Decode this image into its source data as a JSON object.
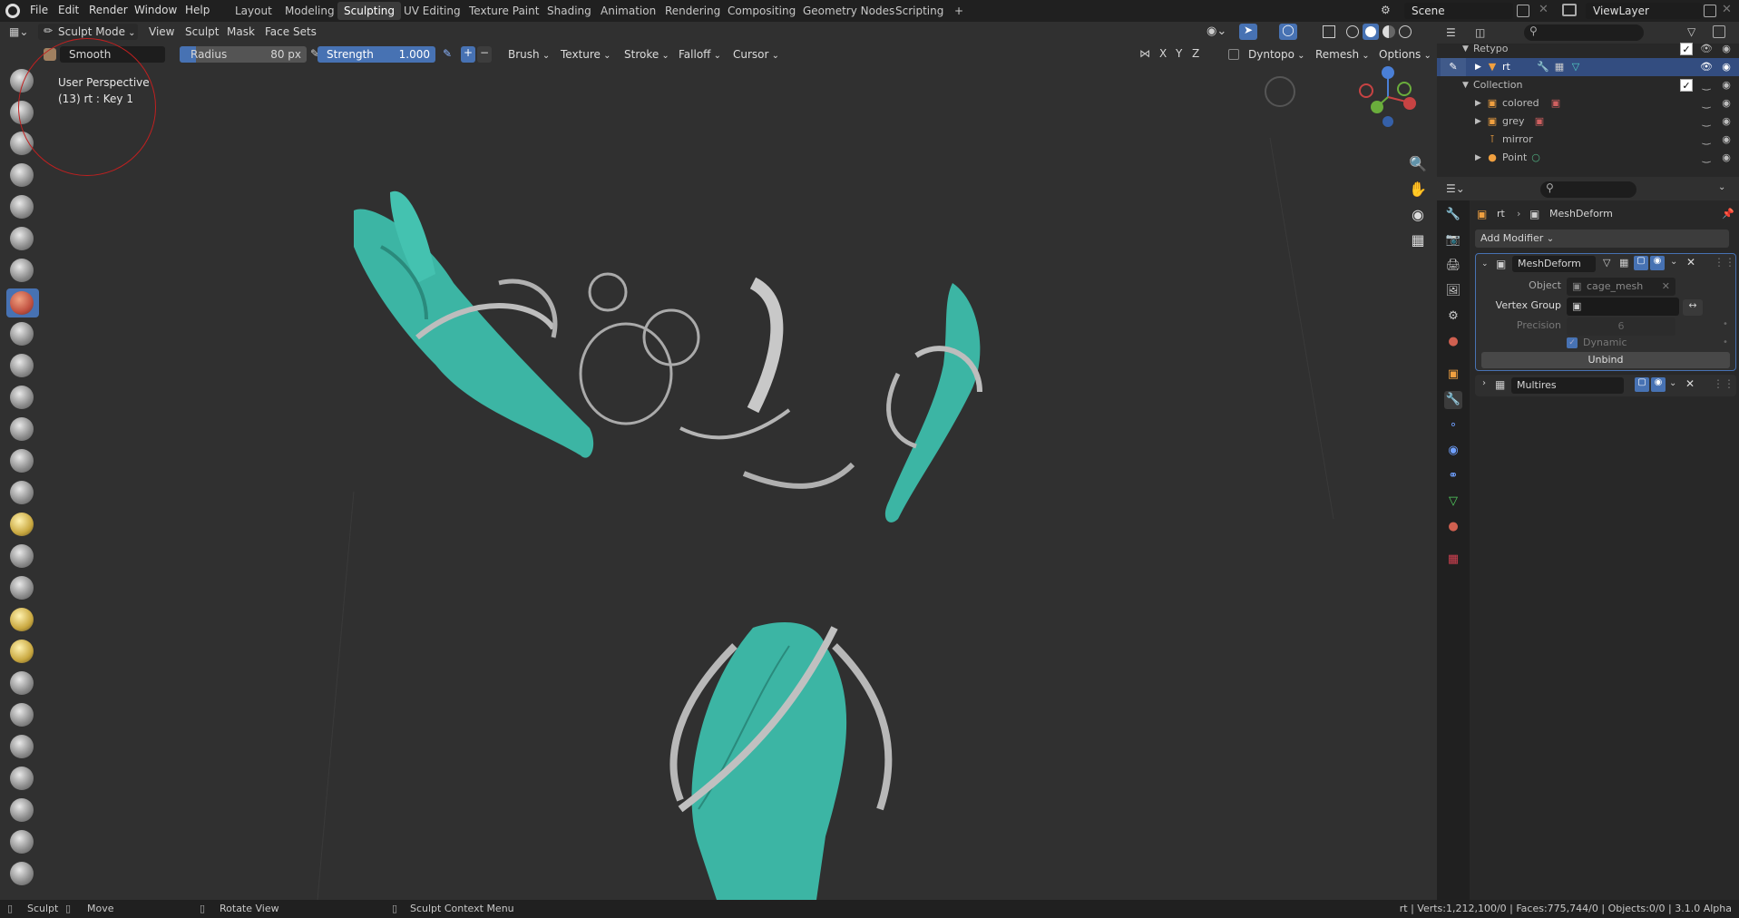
{
  "menubar": {
    "items": [
      "File",
      "Edit",
      "Render",
      "Window",
      "Help"
    ],
    "workspaces": [
      "Layout",
      "Modeling",
      "Sculpting",
      "UV Editing",
      "Texture Paint",
      "Shading",
      "Animation",
      "Rendering",
      "Compositing",
      "Geometry Nodes",
      "Scripting",
      "+"
    ],
    "active_workspace": "Sculpting",
    "scene": "Scene",
    "view_layer": "ViewLayer"
  },
  "header": {
    "mode": "Sculpt Mode",
    "menus": [
      "View",
      "Sculpt",
      "Mask",
      "Face Sets"
    ]
  },
  "tool_settings": {
    "brush_name": "Smooth",
    "radius_label": "Radius",
    "radius_value": "80 px",
    "strength_label": "Strength",
    "strength_value": "1.000",
    "menus": [
      "Brush",
      "Texture",
      "Stroke",
      "Falloff",
      "Cursor"
    ],
    "axes": [
      "X",
      "Y",
      "Z"
    ],
    "dyntopo": "Dyntopo",
    "remesh": "Remesh",
    "options": "Options"
  },
  "viewport": {
    "perspective": "User Perspective",
    "object_info": "(13) rt : Key 1",
    "accent_color": "#3cb5a4"
  },
  "outliner": {
    "rows": [
      {
        "label": "Retypo",
        "depth": 1,
        "selected": false
      },
      {
        "label": "rt",
        "depth": 2,
        "selected": true
      },
      {
        "label": "Collection",
        "depth": 1,
        "selected": false
      },
      {
        "label": "colored",
        "depth": 2,
        "selected": false
      },
      {
        "label": "grey",
        "depth": 2,
        "selected": false
      },
      {
        "label": "mirror",
        "depth": 2,
        "selected": false
      },
      {
        "label": "Point",
        "depth": 2,
        "selected": false
      }
    ]
  },
  "properties": {
    "breadcrumb_object": "rt",
    "breadcrumb_modifier": "MeshDeform",
    "add_modifier": "Add Modifier",
    "meshdeform": {
      "name": "MeshDeform",
      "object_label": "Object",
      "object_value": "cage_mesh",
      "vertex_group_label": "Vertex Group",
      "precision_label": "Precision",
      "precision_value": "6",
      "dynamic_label": "Dynamic",
      "unbind_label": "Unbind"
    },
    "multires": {
      "name": "Multires"
    }
  },
  "statusbar": {
    "left": [
      "Sculpt",
      "Move",
      "Rotate View",
      "Sculpt Context Menu"
    ],
    "right": "rt | Verts:1,212,100/0 | Faces:775,744/0 | Objects:0/0 | 3.1.0 Alpha"
  }
}
